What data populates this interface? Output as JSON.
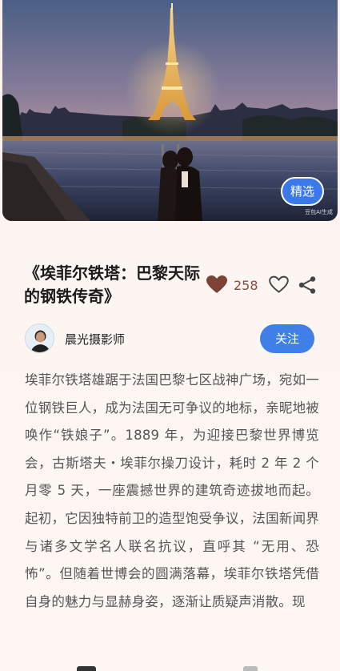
{
  "hero": {
    "badge_label": "精选",
    "watermark": "豆包AI生成"
  },
  "article": {
    "title": "《埃菲尔铁塔：巴黎天际的钢铁传奇》",
    "like_count": "258",
    "body": "埃菲尔铁塔雄踞于法国巴黎七区战神广场，宛如一位钢铁巨人，成为法国无可争议的地标，亲昵地被唤作“铁娘子”。1889 年，为迎接巴黎世界博览会，古斯塔夫・埃菲尔操刀设计，耗时 2 年 2 个月零 5 天，一座震撼世界的建筑奇迹拔地而起。起初，它因独特前卫的造型饱受争议，法国新闻界与诸多文学名人联名抗议，直呼其 “无用、恐怖”。但随着世博会的圆满落幕，埃菲尔铁塔凭借自身的魅力与显赫身姿，逐渐让质疑声消散。现"
  },
  "author": {
    "name": "晨光摄影师",
    "follow_label": "关注"
  },
  "icons": {
    "like": "heart-filled-icon",
    "favorite": "heart-outline-icon",
    "share": "share-icon"
  },
  "colors": {
    "accent": "#3f7fe8",
    "like": "#8a4b3e"
  }
}
